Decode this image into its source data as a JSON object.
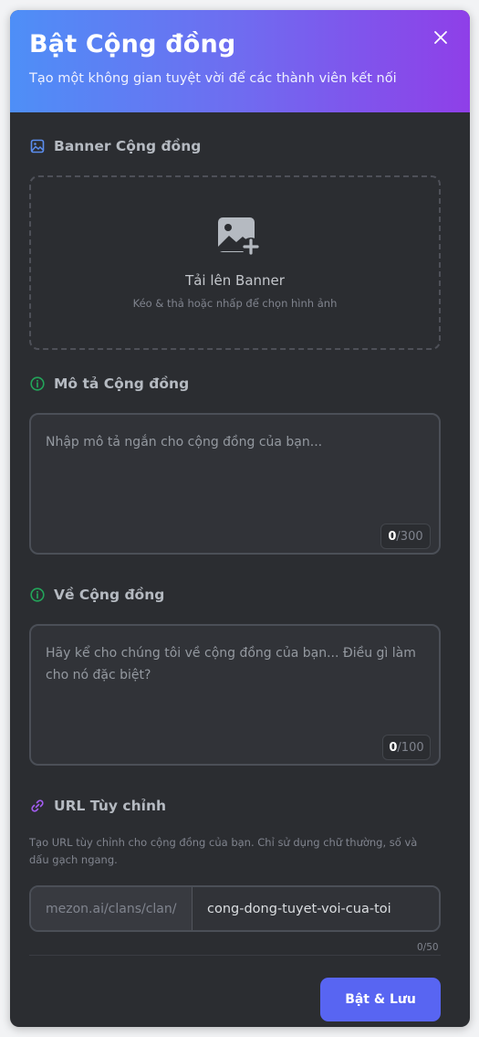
{
  "header": {
    "title": "Bật Cộng đồng",
    "subtitle": "Tạo một không gian tuyệt vời để các thành viên kết nối",
    "close_icon": "close-icon"
  },
  "banner": {
    "label": "Banner Cộng đồng",
    "upload_title": "Tải lên Banner",
    "upload_hint": "Kéo & thả hoặc nhấp để chọn hình ảnh"
  },
  "description": {
    "label": "Mô tả Cộng đồng",
    "placeholder": "Nhập mô tả ngắn cho cộng đồng của bạn...",
    "count": "0",
    "max": "/300"
  },
  "about": {
    "label": "Về Cộng đồng",
    "placeholder": "Hãy kể cho chúng tôi về cộng đồng của bạn... Điều gì làm cho nó đặc biệt?",
    "count": "0",
    "max": "/100"
  },
  "url": {
    "label": "URL Tùy chỉnh",
    "hint": "Tạo URL tùy chỉnh cho cộng đồng của bạn. Chỉ sử dụng chữ thường, số và dấu gạch ngang.",
    "prefix": "mezon.ai/clans/clan/",
    "value": "cong-dong-tuyet-voi-cua-toi",
    "counter": "0/50"
  },
  "actions": {
    "save_label": "Bật & Lưu"
  },
  "colors": {
    "accent": "#5865f2",
    "banner_icon": "#5b8dee",
    "info_icon": "#23a55a",
    "link_icon": "#a25cf0"
  }
}
